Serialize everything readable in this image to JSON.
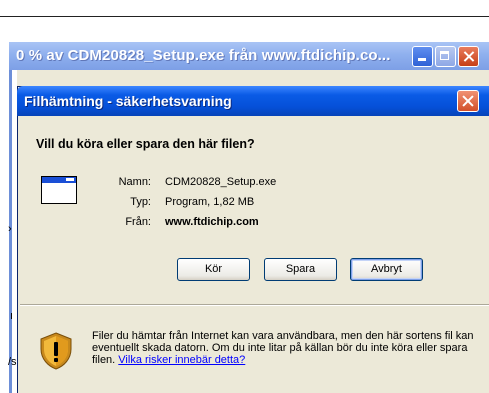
{
  "background_window": {
    "title": "0 % av CDM20828_Setup.exe från www.ftdichip.co..."
  },
  "dialog": {
    "title": "Filhämtning - säkerhetsvarning",
    "question": "Vill du köra eller spara den här filen?",
    "fields": [
      {
        "label": "Namn:",
        "value": "CDM20828_Setup.exe"
      },
      {
        "label": "Typ:",
        "value": "Program, 1,82 MB"
      },
      {
        "label": "Från:",
        "value": "www.ftdichip.com"
      }
    ],
    "buttons": {
      "run": "Kör",
      "save": "Spara",
      "cancel": "Avbryt"
    },
    "warning": {
      "text": "Filer du hämtar från Internet kan vara användbara, men den här sortens fil kan eventuellt skada datorn. Om du inte litar på källan bör du inte köra eller spara filen. ",
      "link": "Vilka risker innebär detta?"
    }
  },
  "edge_fragments": {
    "left_lower": "/s",
    "right_lower": "s"
  },
  "colors": {
    "dialog_title_blue": "#0550d8",
    "face": "#ece9d8",
    "link": "#0000ff",
    "close_red": "#d2502a"
  }
}
